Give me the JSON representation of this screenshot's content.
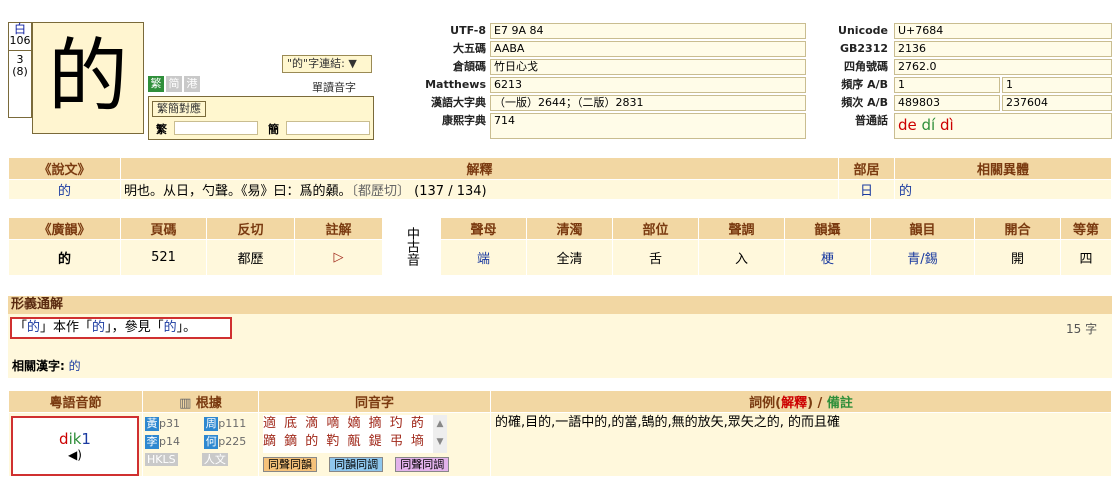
{
  "character": {
    "radical": "白",
    "radical_no": "106",
    "extra_strokes": "3",
    "total_strokes": "(8)",
    "glyph": "的"
  },
  "variants": [
    {
      "label": "繁",
      "active": true
    },
    {
      "label": "简",
      "active": false
    },
    {
      "label": "港",
      "active": false
    }
  ],
  "link_select": "\"的\"字連結: ▼",
  "single_read": "單讀音字",
  "correspondence": {
    "tab": "繁簡對應",
    "trad_label": "繁",
    "simp_label": "簡"
  },
  "codes_mid": [
    {
      "label": "UTF-8",
      "value": "E7 9A 84"
    },
    {
      "label": "大五碼",
      "value": "AABA"
    },
    {
      "label": "倉頡碼",
      "value": "竹日心戈"
    },
    {
      "label": "Matthews",
      "value": "6213"
    },
    {
      "label": "漢語大字典",
      "value": "（一版）2644；（二版）2831"
    },
    {
      "label": "康熙字典",
      "value": "714"
    }
  ],
  "codes_right": {
    "unicode": {
      "label": "Unicode",
      "value": "U+7684"
    },
    "gb2312": {
      "label": "GB2312",
      "value": "2136"
    },
    "four_corner": {
      "label": "四角號碼",
      "value": "2762.0"
    },
    "freq_rank": {
      "label": "頻序 A/B",
      "a": "1",
      "b": "1"
    },
    "freq_count": {
      "label": "頻次 A/B",
      "a": "489803",
      "b": "237604"
    },
    "putonghua": {
      "label": "普通話",
      "p1": "de",
      "p2": "dí",
      "p3": "dì"
    }
  },
  "shuowen": {
    "headers": [
      "《說文》",
      "解釋",
      "部居",
      "相關異體"
    ],
    "row": {
      "char": "的",
      "explanation": "明也。从日，勺聲。《易》曰：爲的顙。",
      "fanqie": "〔都歷切〕",
      "ref": "(137 / 134)",
      "bu": "日",
      "variant": "的"
    }
  },
  "guangyun": {
    "headers": [
      "《廣韻》",
      "頁碼",
      "反切",
      "註解",
      "中古音",
      "聲母",
      "清濁",
      "部位",
      "聲調",
      "韻攝",
      "韻目",
      "開合",
      "等第"
    ],
    "row": [
      "的",
      "521",
      "都歷",
      "▷",
      "",
      "端",
      "全清",
      "舌",
      "入",
      "梗",
      "青/錫",
      "開",
      "四"
    ]
  },
  "xingyi": {
    "title": "形義通解",
    "text_a": "「",
    "text_b": "的",
    "text_c": "」本作「",
    "text_d": "的",
    "text_e": "」，參見「",
    "text_f": "的",
    "text_g": "」。",
    "wordcount": "15 字",
    "related_label": "相關漢字:",
    "related_value": "的"
  },
  "cantonese": {
    "headers": [
      "粵語音節",
      "根據",
      "同音字",
      "詞例(解釋) / 備註"
    ],
    "header_paren": "解釋",
    "header_note": "備註",
    "rom_initial": "d",
    "rom_final": "ik",
    "rom_tone": "1",
    "speaker": "◀)",
    "sources": [
      {
        "badge": "黃",
        "page": "p31"
      },
      {
        "badge": "周",
        "page": "p111"
      },
      {
        "badge": "李",
        "page": "p14"
      },
      {
        "badge": "何",
        "page": "p225"
      }
    ],
    "source_tags": [
      "HKLS",
      "人文"
    ],
    "homophones_line1": "適 底 滴 嘀 嫡 摘 玓 菂",
    "homophones_line2": "蹢 鏑 的 靮 甋 鍉 弔 墒",
    "hom_buttons": [
      "同聲同韻",
      "同韻同調",
      "同聲同調"
    ],
    "examples": "的確,目的,一語中的,的當,鵠的,無的放矢,眾矢之的, 的而且確"
  },
  "colors": {
    "header_bg": "#f2d7a3",
    "row_bg": "#fff8dc",
    "highlight_border": "#d03030"
  }
}
